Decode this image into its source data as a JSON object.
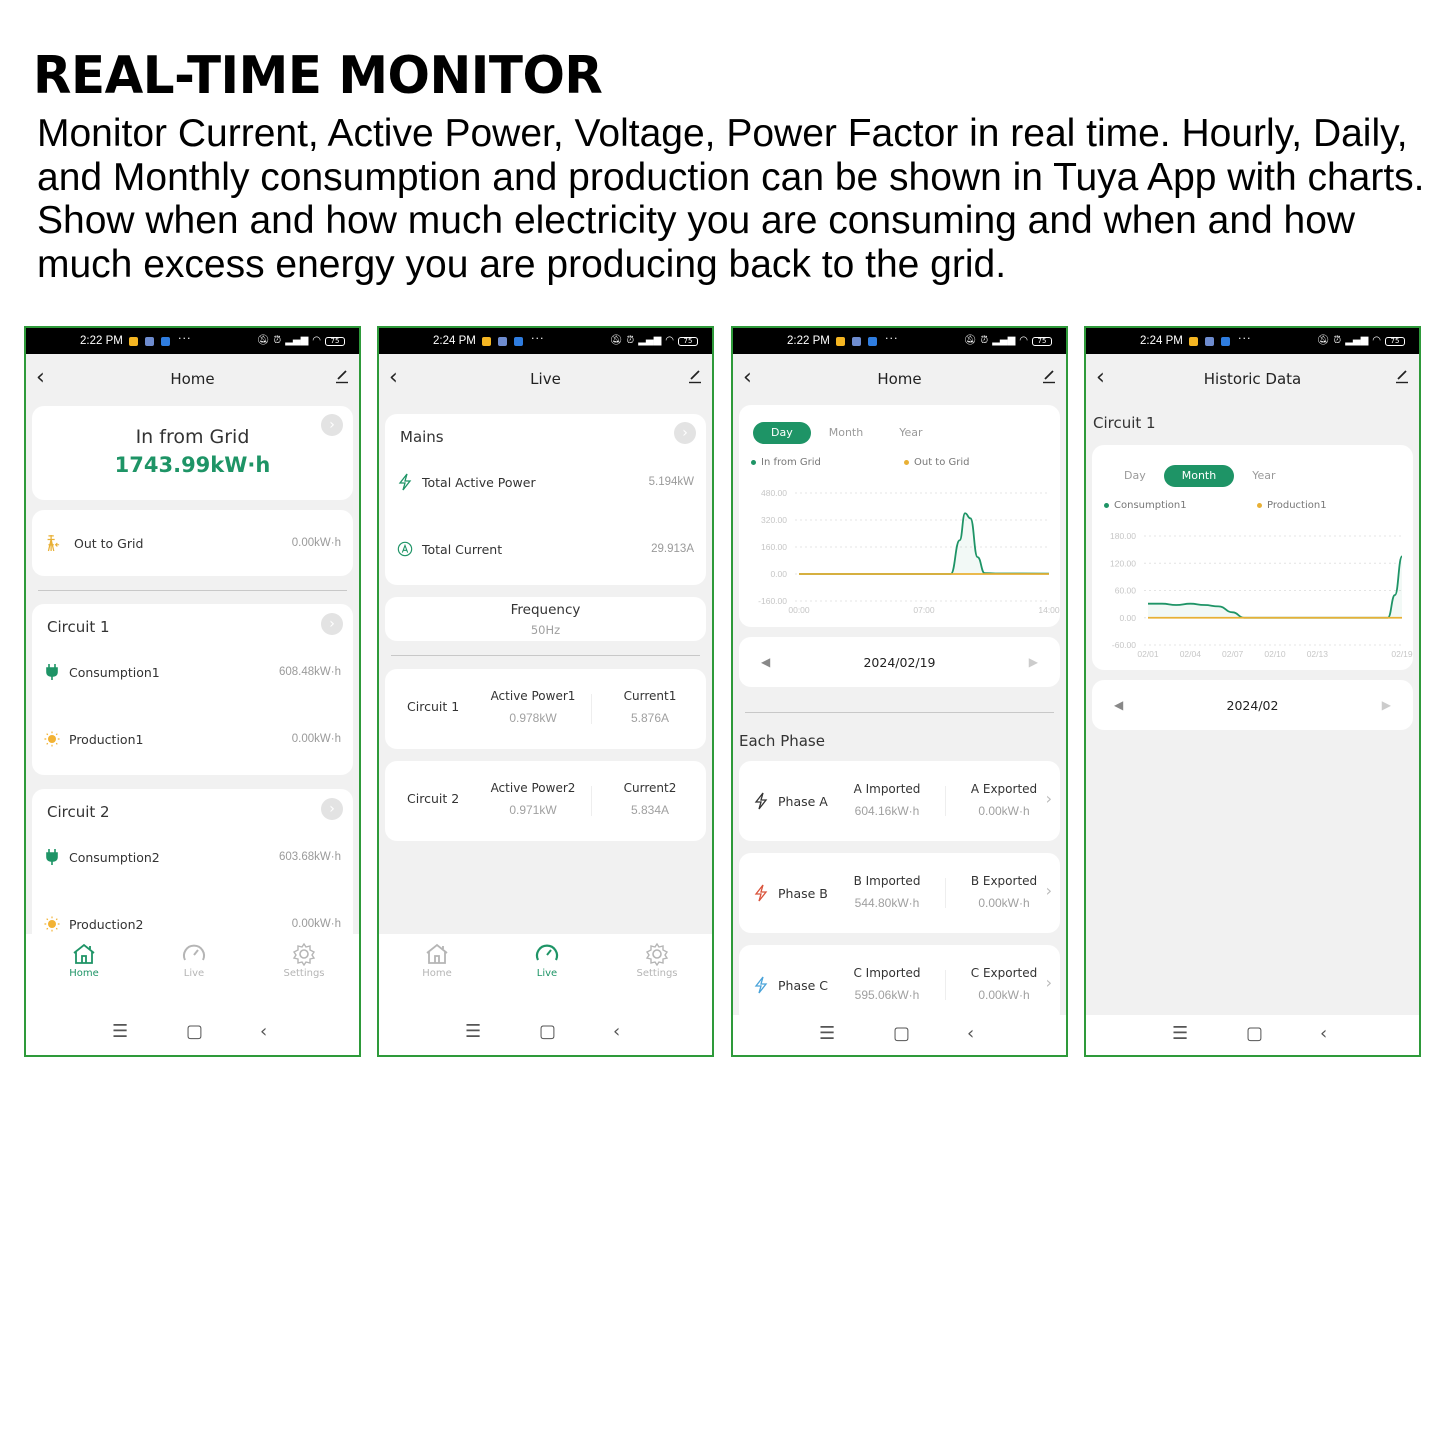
{
  "hero": {
    "title": "REAL-TIME MONITOR",
    "description": "Monitor Current, Active Power, Voltage, Power Factor in real time. Hourly, Daily, and Monthly consumption and production can be shown in Tuya App with charts. Show when and how much electricity you are consuming and when and how much excess energy you are producing back to the grid."
  },
  "colors": {
    "accent": "#1e9466",
    "production": "#e8b035",
    "frame": "#2e9a3a",
    "phaseB": "#d9533b",
    "phaseC": "#4aa3d9"
  },
  "statusbar": {
    "battery": "75"
  },
  "nav_tabs": {
    "home": "Home",
    "live": "Live",
    "settings": "Settings"
  },
  "screens": {
    "home": {
      "time": "2:22 PM",
      "title": "Home",
      "in_from_grid": {
        "label": "In from Grid",
        "value": "1743.99kW·h"
      },
      "out_to_grid": {
        "label": "Out to Grid",
        "value": "0.00kW·h"
      },
      "circuits": [
        {
          "title": "Circuit 1",
          "consumption_label": "Consumption1",
          "consumption_value": "608.48kW·h",
          "production_label": "Production1",
          "production_value": "0.00kW·h"
        },
        {
          "title": "Circuit 2",
          "consumption_label": "Consumption2",
          "consumption_value": "603.68kW·h",
          "production_label": "Production2",
          "production_value": "0.00kW·h"
        }
      ]
    },
    "live": {
      "time": "2:24 PM",
      "title": "Live",
      "mains": {
        "title": "Mains",
        "total_power_label": "Total Active Power",
        "total_power_value": "5.194kW",
        "total_current_label": "Total Current",
        "total_current_value": "29.913A"
      },
      "frequency": {
        "label": "Frequency",
        "value": "50Hz"
      },
      "circuits": [
        {
          "title": "Circuit 1",
          "power_label": "Active Power1",
          "power_value": "0.978kW",
          "current_label": "Current1",
          "current_value": "5.876A"
        },
        {
          "title": "Circuit 2",
          "power_label": "Active Power2",
          "power_value": "0.971kW",
          "current_label": "Current2",
          "current_value": "5.834A"
        }
      ]
    },
    "home_chart": {
      "time": "2:22 PM",
      "title": "Home",
      "periods": [
        "Day",
        "Month",
        "Year"
      ],
      "active_period": "Day",
      "date": "2024/02/19",
      "each_phase_title": "Each Phase",
      "phases": [
        {
          "name": "Phase A",
          "imported_label": "A Imported",
          "imported_value": "604.16kW·h",
          "exported_label": "A Exported",
          "exported_value": "0.00kW·h"
        },
        {
          "name": "Phase B",
          "imported_label": "B Imported",
          "imported_value": "544.80kW·h",
          "exported_label": "B Exported",
          "exported_value": "0.00kW·h"
        },
        {
          "name": "Phase C",
          "imported_label": "C Imported",
          "imported_value": "595.06kW·h",
          "exported_label": "C Exported",
          "exported_value": "0.00kW·h"
        }
      ]
    },
    "historic": {
      "time": "2:24 PM",
      "title": "Historic Data",
      "section_title": "Circuit 1",
      "periods": [
        "Day",
        "Month",
        "Year"
      ],
      "active_period": "Month",
      "date": "2024/02"
    }
  },
  "chart_data": [
    {
      "type": "line",
      "title": "",
      "xlabel": "",
      "ylabel": "",
      "ylim": [
        -160,
        480
      ],
      "yticks": [
        "480.00",
        "320.00",
        "160.00",
        "0.00",
        "-160.00"
      ],
      "ytick_values": [
        480,
        320,
        160,
        0,
        -160
      ],
      "xlim": [
        0,
        14
      ],
      "xticks": [
        "00:00",
        "07:00",
        "14:00"
      ],
      "xtick_values": [
        0,
        7,
        14
      ],
      "grid": true,
      "legend": "top",
      "series": [
        {
          "name": "In from Grid",
          "color": "#1e9466",
          "x": [
            0,
            8,
            8.5,
            9,
            9.3,
            9.6,
            10,
            10.4,
            11,
            14
          ],
          "y": [
            0,
            0,
            0,
            200,
            360,
            330,
            100,
            5,
            3,
            2
          ]
        },
        {
          "name": "Out to Grid",
          "color": "#e8b035",
          "x": [
            0,
            14
          ],
          "y": [
            0,
            0
          ]
        }
      ]
    },
    {
      "type": "line",
      "title": "",
      "xlabel": "",
      "ylabel": "",
      "ylim": [
        -60,
        180
      ],
      "yticks": [
        "180.00",
        "120.00",
        "60.00",
        "0.00",
        "-60.00"
      ],
      "ytick_values": [
        180,
        120,
        60,
        0,
        -60
      ],
      "xlim": [
        1,
        19
      ],
      "xticks": [
        "02/01",
        "02/04",
        "02/07",
        "02/10",
        "02/13",
        "02/19"
      ],
      "xtick_values": [
        1,
        4,
        7,
        10,
        13,
        19
      ],
      "grid": true,
      "legend": "top",
      "series": [
        {
          "name": "Consumption1",
          "color": "#1e9466",
          "x": [
            1,
            2,
            3,
            4,
            5,
            6,
            7,
            7.8,
            18,
            18.5,
            19
          ],
          "y": [
            31,
            31,
            28,
            31,
            28,
            25,
            12,
            0,
            0,
            50,
            135
          ]
        },
        {
          "name": "Production1",
          "color": "#e8b035",
          "x": [
            1,
            19
          ],
          "y": [
            0,
            0
          ]
        }
      ]
    }
  ]
}
